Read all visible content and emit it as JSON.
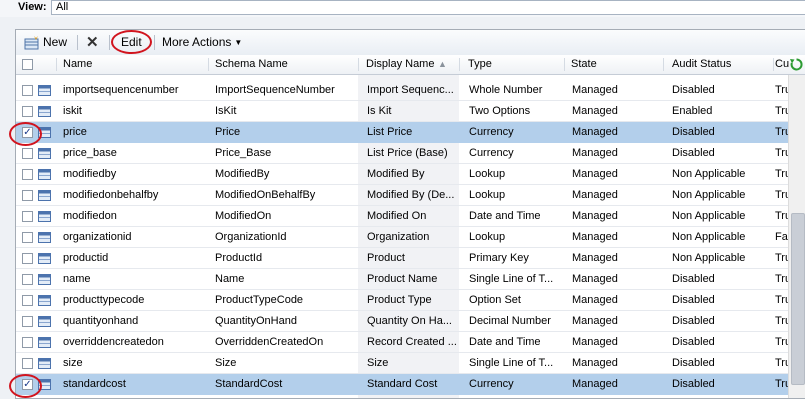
{
  "view": {
    "label": "View:",
    "value": "All"
  },
  "toolbar": {
    "new_label": "New",
    "delete_label": "✕",
    "edit_label": "Edit",
    "more_label": "More Actions"
  },
  "columns": [
    "Name",
    "Schema Name",
    "Display Name",
    "Type",
    "State",
    "Audit Status",
    "Cu"
  ],
  "rows": [
    {
      "checked": false,
      "selected": false,
      "name": "importsequencenumber",
      "schema": "ImportSequenceNumber",
      "display": "Import Sequenc...",
      "type": "Whole Number",
      "state": "Managed",
      "audit": "Disabled",
      "cu": "Tru"
    },
    {
      "checked": false,
      "selected": false,
      "name": "iskit",
      "schema": "IsKit",
      "display": "Is Kit",
      "type": "Two Options",
      "state": "Managed",
      "audit": "Enabled",
      "cu": "Tru"
    },
    {
      "checked": true,
      "selected": true,
      "name": "price",
      "schema": "Price",
      "display": "List Price",
      "type": "Currency",
      "state": "Managed",
      "audit": "Disabled",
      "cu": "Tru"
    },
    {
      "checked": false,
      "selected": false,
      "name": "price_base",
      "schema": "Price_Base",
      "display": "List Price (Base)",
      "type": "Currency",
      "state": "Managed",
      "audit": "Disabled",
      "cu": "Tru"
    },
    {
      "checked": false,
      "selected": false,
      "name": "modifiedby",
      "schema": "ModifiedBy",
      "display": "Modified By",
      "type": "Lookup",
      "state": "Managed",
      "audit": "Non Applicable",
      "cu": "Tru"
    },
    {
      "checked": false,
      "selected": false,
      "name": "modifiedonbehalfby",
      "schema": "ModifiedOnBehalfBy",
      "display": "Modified By (De...",
      "type": "Lookup",
      "state": "Managed",
      "audit": "Non Applicable",
      "cu": "Tru"
    },
    {
      "checked": false,
      "selected": false,
      "name": "modifiedon",
      "schema": "ModifiedOn",
      "display": "Modified On",
      "type": "Date and Time",
      "state": "Managed",
      "audit": "Non Applicable",
      "cu": "Tru"
    },
    {
      "checked": false,
      "selected": false,
      "name": "organizationid",
      "schema": "OrganizationId",
      "display": "Organization",
      "type": "Lookup",
      "state": "Managed",
      "audit": "Non Applicable",
      "cu": "Fa"
    },
    {
      "checked": false,
      "selected": false,
      "name": "productid",
      "schema": "ProductId",
      "display": "Product",
      "type": "Primary Key",
      "state": "Managed",
      "audit": "Non Applicable",
      "cu": "Tru"
    },
    {
      "checked": false,
      "selected": false,
      "name": "name",
      "schema": "Name",
      "display": "Product Name",
      "type": "Single Line of T...",
      "state": "Managed",
      "audit": "Disabled",
      "cu": "Tru"
    },
    {
      "checked": false,
      "selected": false,
      "name": "producttypecode",
      "schema": "ProductTypeCode",
      "display": "Product Type",
      "type": "Option Set",
      "state": "Managed",
      "audit": "Disabled",
      "cu": "Tru"
    },
    {
      "checked": false,
      "selected": false,
      "name": "quantityonhand",
      "schema": "QuantityOnHand",
      "display": "Quantity On Ha...",
      "type": "Decimal Number",
      "state": "Managed",
      "audit": "Disabled",
      "cu": "Tru"
    },
    {
      "checked": false,
      "selected": false,
      "name": "overriddencreatedon",
      "schema": "OverriddenCreatedOn",
      "display": "Record Created ...",
      "type": "Date and Time",
      "state": "Managed",
      "audit": "Disabled",
      "cu": "Tru"
    },
    {
      "checked": false,
      "selected": false,
      "name": "size",
      "schema": "Size",
      "display": "Size",
      "type": "Single Line of T...",
      "state": "Managed",
      "audit": "Disabled",
      "cu": "Tru"
    },
    {
      "checked": true,
      "selected": true,
      "name": "standardcost",
      "schema": "StandardCost",
      "display": "Standard Cost",
      "type": "Currency",
      "state": "Managed",
      "audit": "Disabled",
      "cu": "Tru"
    }
  ]
}
